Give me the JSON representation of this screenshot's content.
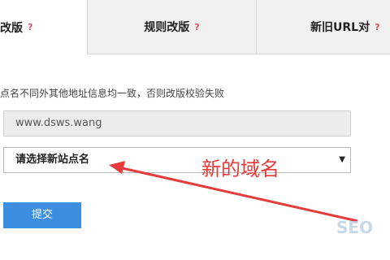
{
  "tabs": [
    {
      "label": "改版",
      "help": "?"
    },
    {
      "label": "规则改版",
      "help": "?"
    },
    {
      "label": "新旧URL对",
      "help": "?"
    }
  ],
  "form": {
    "hint": "点名不同外其他地址信息均一致，否则改版校验失败",
    "domain_value": "www.dsws.wang",
    "site_select": {
      "selected": "请选择新站点名"
    },
    "submit_label": "提交"
  },
  "annotation": {
    "text": "新的域名",
    "color": "#e53b3b"
  },
  "watermark": {
    "text": "SEO"
  },
  "colors": {
    "accent_button": "#3d8ee0",
    "help_icon": "#e0505a",
    "tab_bar": "#f0f0f0"
  }
}
